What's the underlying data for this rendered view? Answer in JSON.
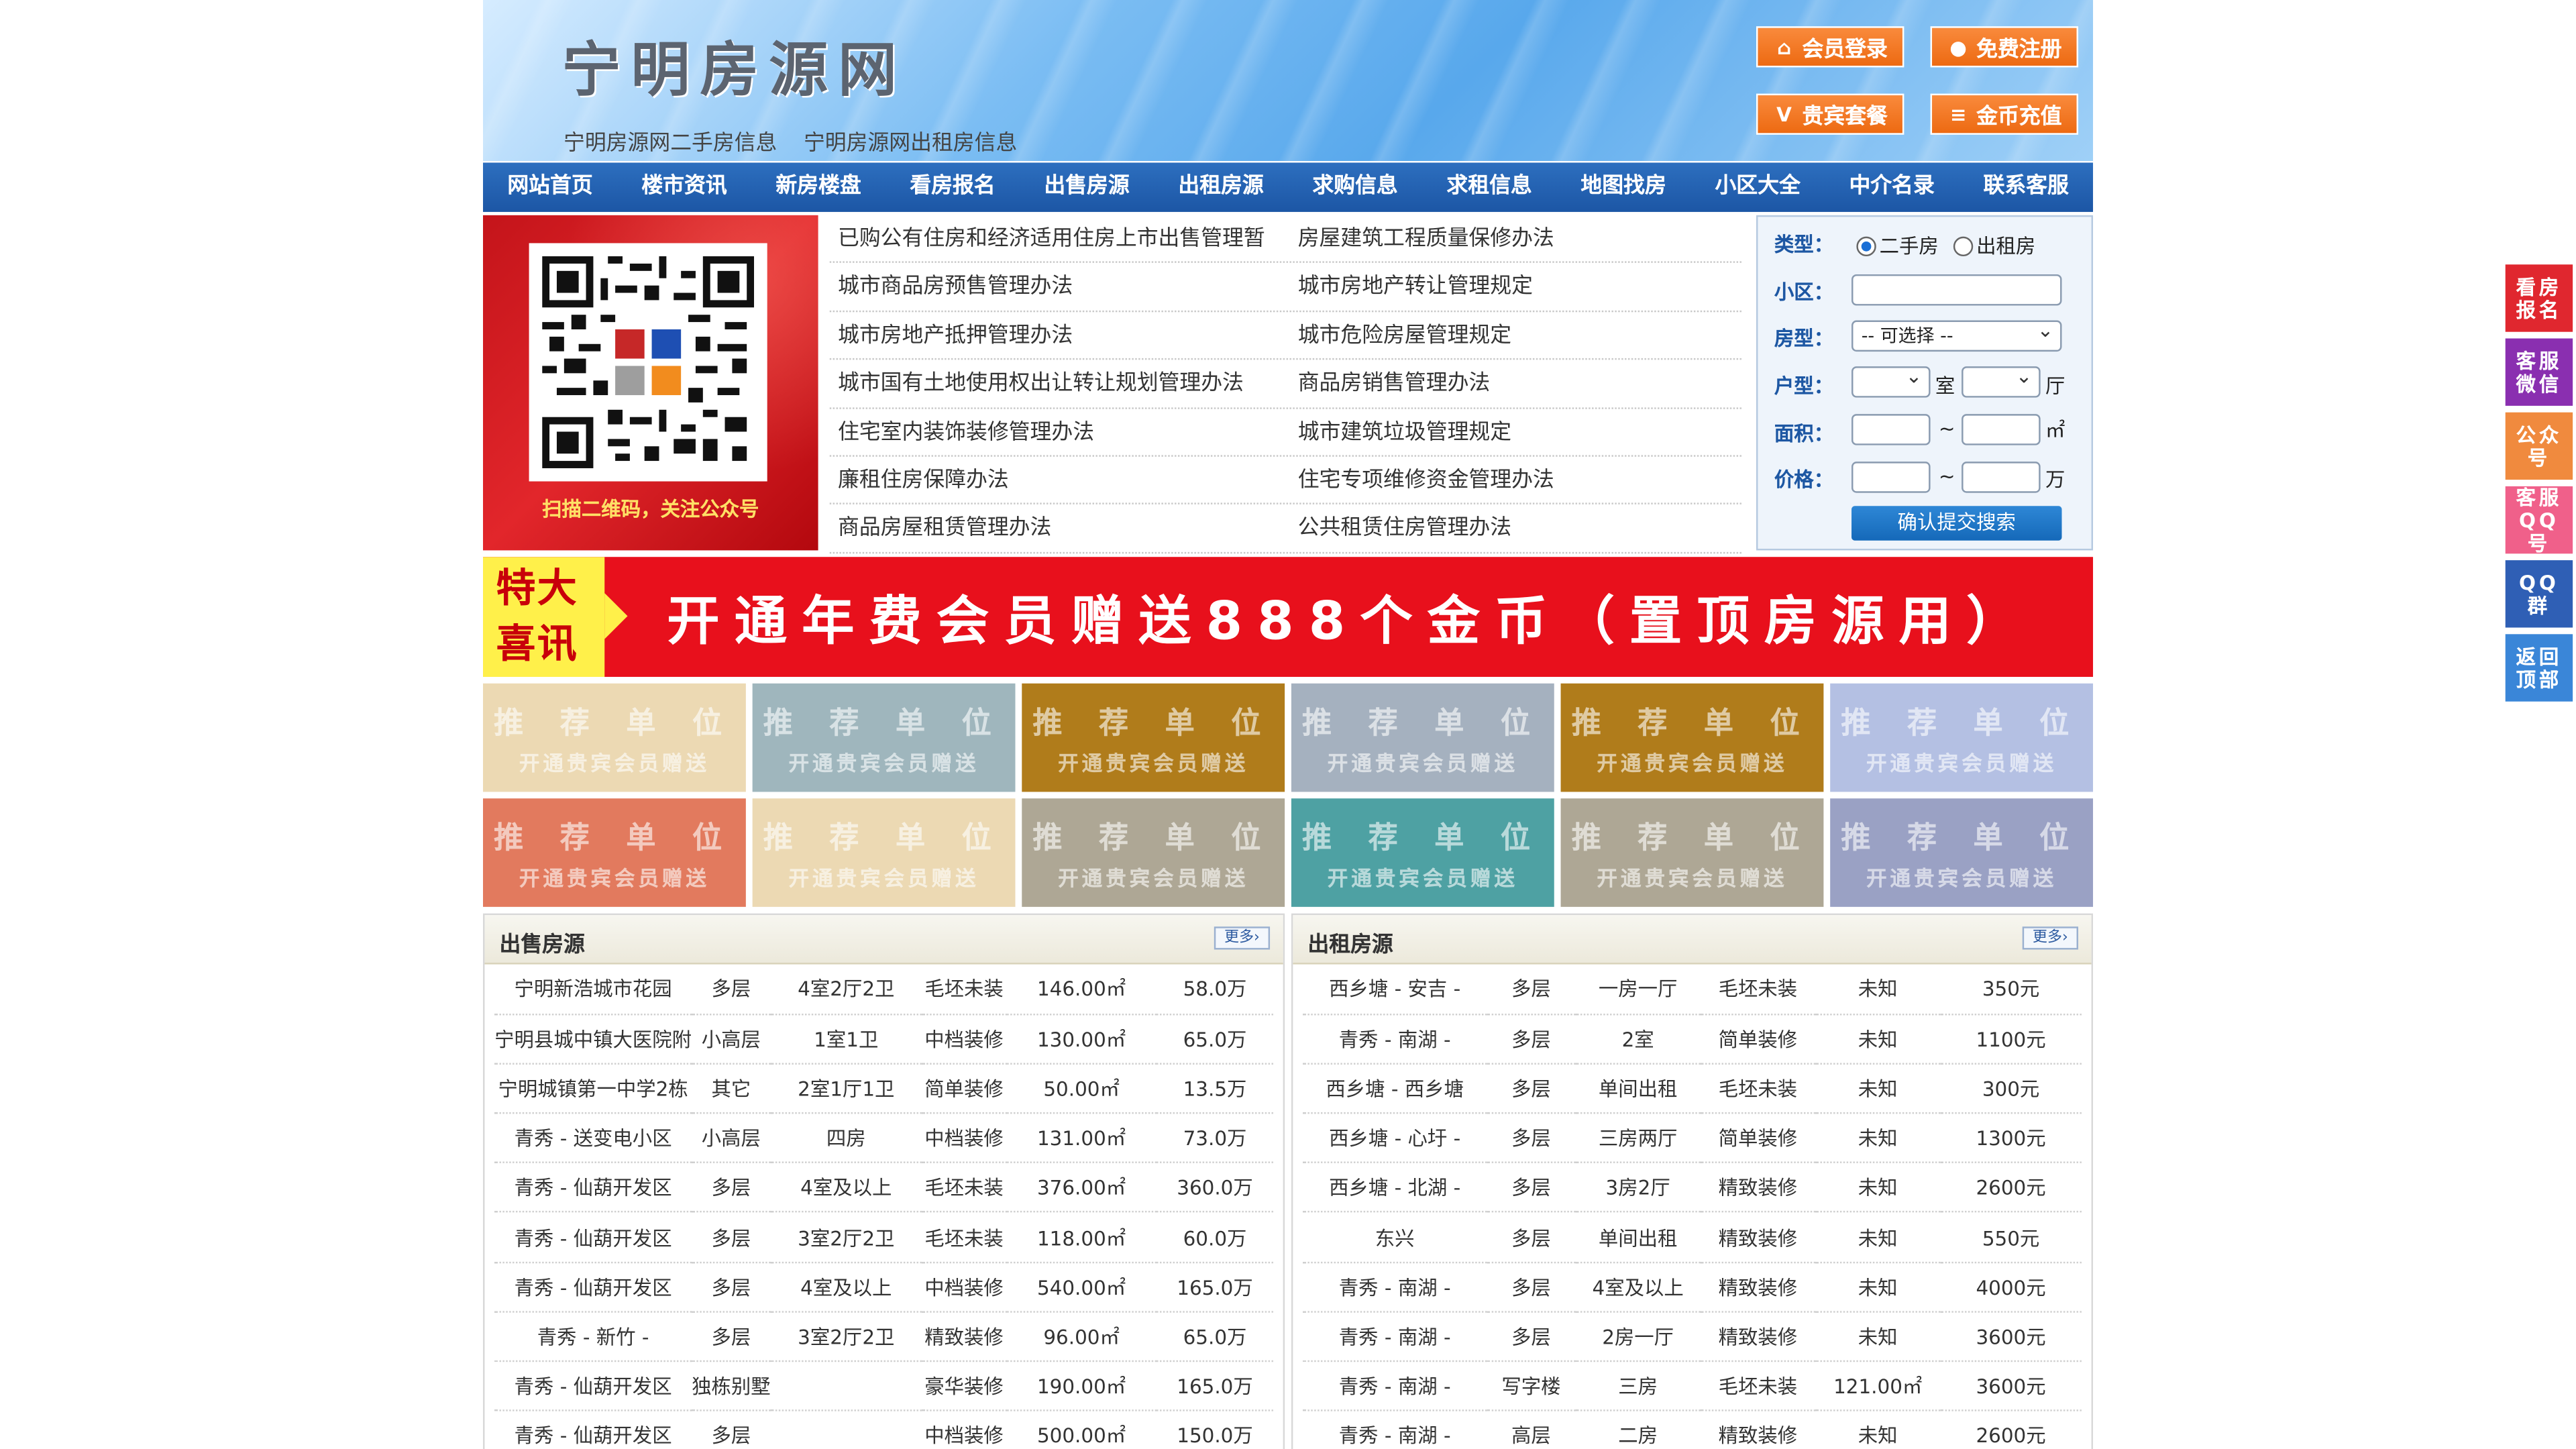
{
  "header": {
    "logo": "宁明房源网",
    "sublinks": [
      "宁明房源网二手房信息",
      "宁明房源网出租房信息"
    ],
    "buttons": {
      "login": "会员登录",
      "register": "免费注册",
      "vip": "贵宾套餐",
      "coin": "金币充值"
    }
  },
  "nav": [
    "网站首页",
    "楼市资讯",
    "新房楼盘",
    "看房报名",
    "出售房源",
    "出租房源",
    "求购信息",
    "求租信息",
    "地图找房",
    "小区大全",
    "中介名录",
    "联系客服"
  ],
  "qr": {
    "caption": "扫描二维码，关注公众号"
  },
  "policies": [
    [
      "已购公有住房和经济适用住房上市出售管理暂",
      "房屋建筑工程质量保修办法"
    ],
    [
      "城市商品房预售管理办法",
      "城市房地产转让管理规定"
    ],
    [
      "城市房地产抵押管理办法",
      "城市危险房屋管理规定"
    ],
    [
      "城市国有土地使用权出让转让规划管理办法",
      "商品房销售管理办法"
    ],
    [
      "住宅室内装饰装修管理办法",
      "城市建筑垃圾管理规定"
    ],
    [
      "廉租住房保障办法",
      "住宅专项维修资金管理办法"
    ],
    [
      "商品房屋租赁管理办法",
      "公共租赁住房管理办法"
    ]
  ],
  "search": {
    "type_label": "类型：",
    "type_options": [
      "二手房",
      "出租房"
    ],
    "community_label": "小区：",
    "room_type_label": "房型：",
    "room_type_value": "-- 可选择 --",
    "layout_label": "户型：",
    "layout_unit1": "室",
    "layout_unit2": "厅",
    "area_label": "面积：",
    "area_sep": "~",
    "area_unit": "㎡",
    "price_label": "价格：",
    "price_sep": "~",
    "price_unit": "万",
    "submit": "确认提交搜索"
  },
  "banner": {
    "tag_line1": "特大",
    "tag_line2": "喜讯",
    "text": "开通年费会员赠送888个金币（置顶房源用）"
  },
  "promos": {
    "line1": "推 荐 单 位",
    "line2": "开通贵宾会员赠送",
    "colors": [
      "#ecd9b3",
      "#9fb6bd",
      "#b07c1b",
      "#a5b1bf",
      "#b07c1b",
      "#b4c0e3",
      "#e27a5e",
      "#ecd9b3",
      "#aea795",
      "#4ea1a3",
      "#aea795",
      "#9aa1c4"
    ]
  },
  "sale": {
    "title": "出售房源",
    "more": "更多›",
    "rows": [
      [
        "宁明新浩城市花园",
        "多层",
        "4室2厅2卫",
        "毛坯未装",
        "146.00㎡",
        "58.0万"
      ],
      [
        "宁明县城中镇大医院附",
        "小高层",
        "1室1卫",
        "中档装修",
        "130.00㎡",
        "65.0万"
      ],
      [
        "宁明城镇第一中学2栋",
        "其它",
        "2室1厅1卫",
        "简单装修",
        "50.00㎡",
        "13.5万"
      ],
      [
        "青秀 - 送变电小区",
        "小高层",
        "四房",
        "中档装修",
        "131.00㎡",
        "73.0万"
      ],
      [
        "青秀 - 仙葫开发区",
        "多层",
        "4室及以上",
        "毛坯未装",
        "376.00㎡",
        "360.0万"
      ],
      [
        "青秀 - 仙葫开发区",
        "多层",
        "3室2厅2卫",
        "毛坯未装",
        "118.00㎡",
        "60.0万"
      ],
      [
        "青秀 - 仙葫开发区",
        "多层",
        "4室及以上",
        "中档装修",
        "540.00㎡",
        "165.0万"
      ],
      [
        "青秀 - 新竹 -",
        "多层",
        "3室2厅2卫",
        "精致装修",
        "96.00㎡",
        "65.0万"
      ],
      [
        "青秀 - 仙葫开发区",
        "独栋别墅",
        "",
        "豪华装修",
        "190.00㎡",
        "165.0万"
      ],
      [
        "青秀 - 仙葫开发区",
        "多层",
        "",
        "中档装修",
        "500.00㎡",
        "150.0万"
      ]
    ]
  },
  "rent": {
    "title": "出租房源",
    "more": "更多›",
    "rows": [
      [
        "西乡塘 - 安吉 -",
        "多层",
        "一房一厅",
        "毛坯未装",
        "未知",
        "350元"
      ],
      [
        "青秀 - 南湖 -",
        "多层",
        "2室",
        "简单装修",
        "未知",
        "1100元"
      ],
      [
        "西乡塘 - 西乡塘",
        "多层",
        "单间出租",
        "毛坯未装",
        "未知",
        "300元"
      ],
      [
        "西乡塘 - 心圩 -",
        "多层",
        "三房两厅",
        "简单装修",
        "未知",
        "1300元"
      ],
      [
        "西乡塘 - 北湖 -",
        "多层",
        "3房2厅",
        "精致装修",
        "未知",
        "2600元"
      ],
      [
        "东兴",
        "多层",
        "单间出租",
        "精致装修",
        "未知",
        "550元"
      ],
      [
        "青秀 - 南湖 -",
        "多层",
        "4室及以上",
        "精致装修",
        "未知",
        "4000元"
      ],
      [
        "青秀 - 南湖 -",
        "多层",
        "2房一厅",
        "精致装修",
        "未知",
        "3600元"
      ],
      [
        "青秀 - 南湖 -",
        "写字楼",
        "三房",
        "毛坯未装",
        "121.00㎡",
        "3600元"
      ],
      [
        "青秀 - 南湖 -",
        "高层",
        "二房",
        "精致装修",
        "未知",
        "2600元"
      ]
    ]
  },
  "side": [
    {
      "label": "看房报名",
      "color": "#e0272f"
    },
    {
      "label": "客服微信",
      "color": "#8a2fb0"
    },
    {
      "label": "公众号",
      "color": "#f08a3e"
    },
    {
      "label": "客服QQ号",
      "color": "#f0608a"
    },
    {
      "label": "QQ群",
      "color": "#2f5fb5"
    },
    {
      "label": "返回顶部",
      "color": "#3a86d8"
    }
  ]
}
